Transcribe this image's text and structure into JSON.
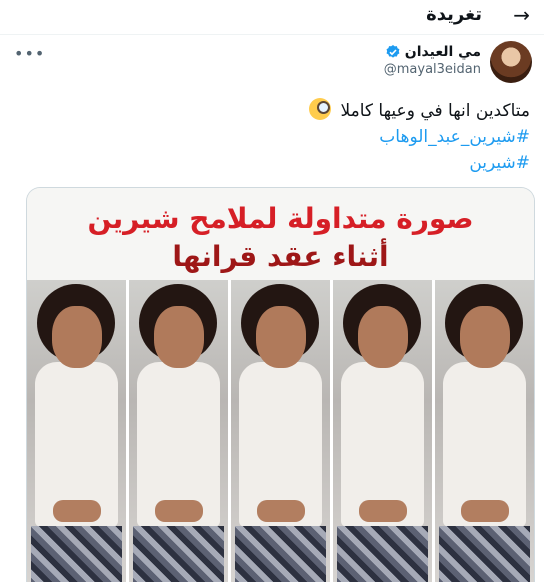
{
  "header": {
    "title": "تغريدة",
    "back_icon": "arrow-left-icon"
  },
  "author": {
    "name": "مي العيدان",
    "handle": "@mayal3eidan",
    "verified": true,
    "verified_color": "#1d9bf0",
    "more_icon": "more-horizontal-icon"
  },
  "tweet": {
    "text": "متاكدين انها في وعيها كاملا",
    "emoji": "face-with-monocle-icon",
    "hashtags": [
      "#شيرين_عبد_الوهاب",
      "#شيرين"
    ],
    "hashtag_color": "#1d9bf0"
  },
  "media": {
    "caption_line1": "صورة متداولة لملامح شيرين",
    "caption_line2": "أثناء عقد قرانها",
    "caption_color": "#d61f26",
    "frame_count": 5
  }
}
